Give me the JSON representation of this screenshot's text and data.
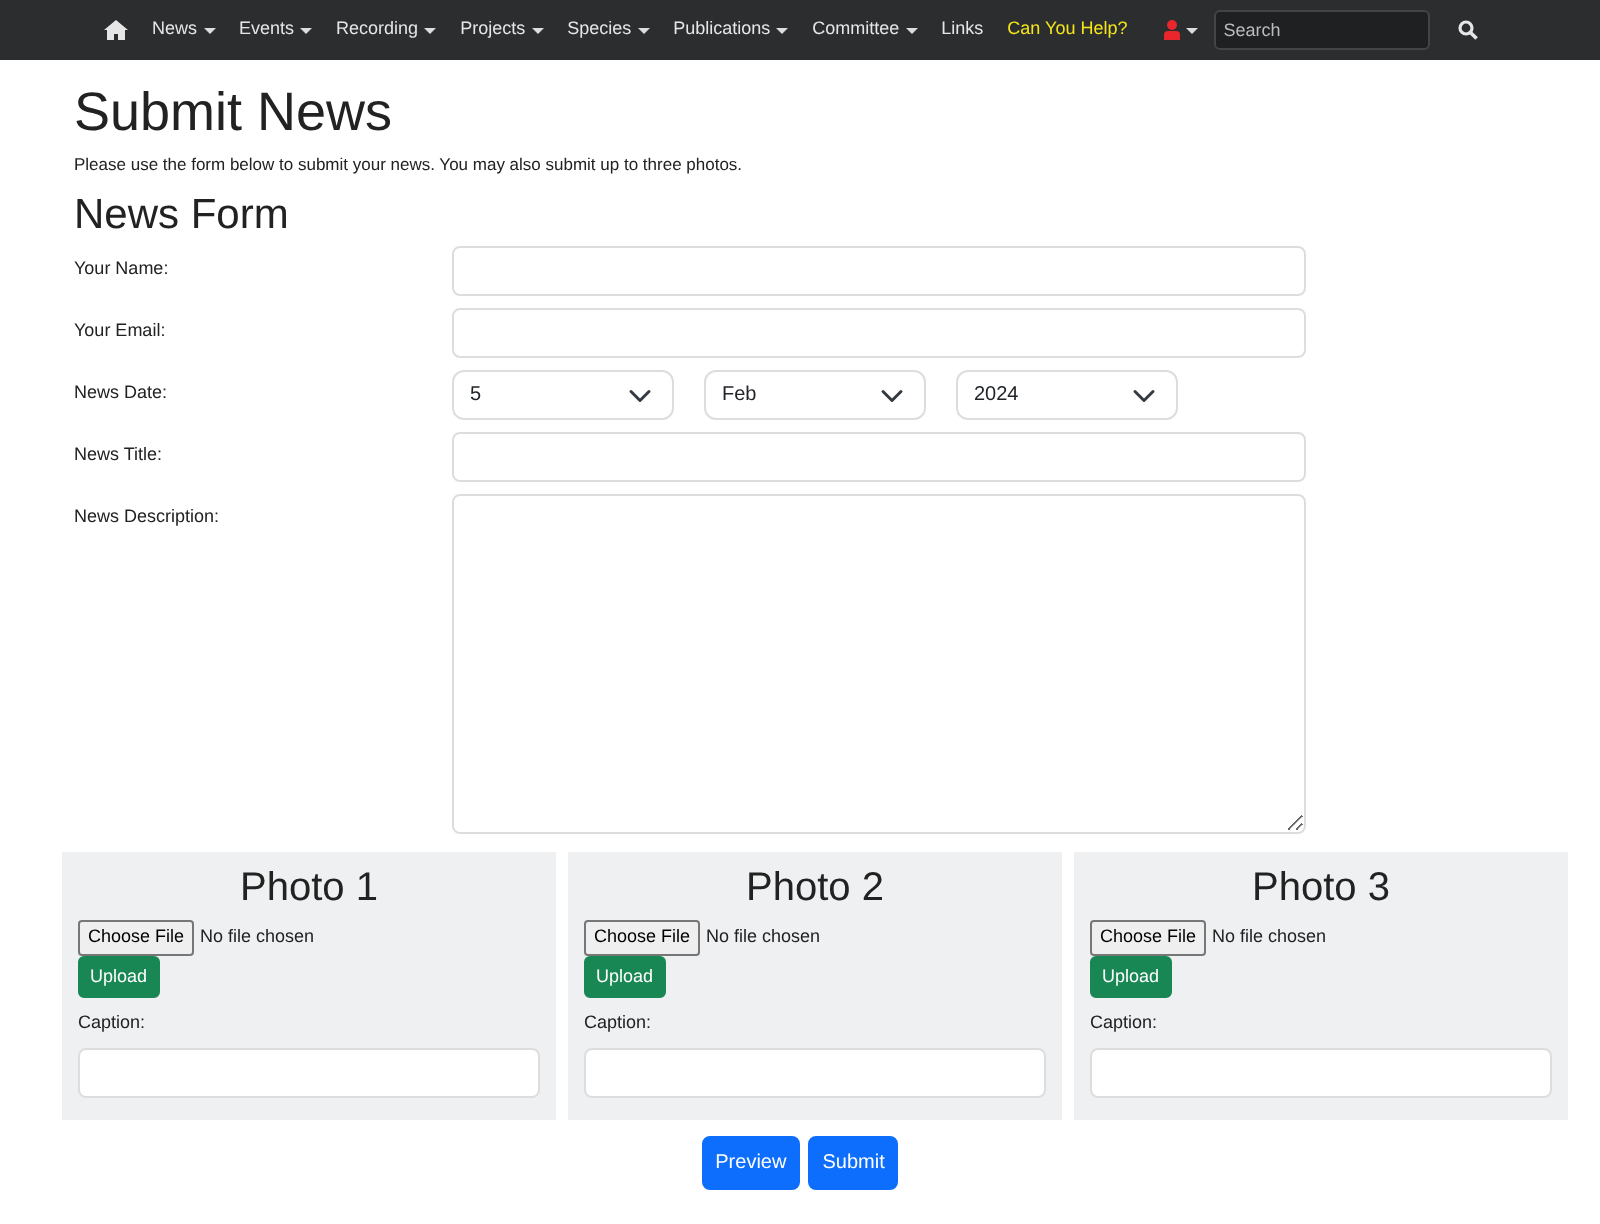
{
  "navbar": {
    "items": [
      {
        "kind": "home",
        "dropdown": false,
        "highlight": false
      },
      {
        "kind": "link",
        "label": "News",
        "dropdown": true,
        "highlight": false
      },
      {
        "kind": "link",
        "label": "Events",
        "dropdown": true,
        "highlight": false
      },
      {
        "kind": "link",
        "label": "Recording",
        "dropdown": true,
        "highlight": false
      },
      {
        "kind": "link",
        "label": "Projects",
        "dropdown": true,
        "highlight": false
      },
      {
        "kind": "link",
        "label": "Species",
        "dropdown": true,
        "highlight": false
      },
      {
        "kind": "link",
        "label": "Publications",
        "dropdown": true,
        "highlight": false
      },
      {
        "kind": "link",
        "label": "Committee",
        "dropdown": true,
        "highlight": false
      },
      {
        "kind": "link",
        "label": "Links",
        "dropdown": false,
        "highlight": false
      },
      {
        "kind": "link",
        "label": "Can You Help?",
        "dropdown": false,
        "highlight": true
      },
      {
        "kind": "user",
        "dropdown": true,
        "highlight": false
      }
    ],
    "search": {
      "placeholder": "Search"
    }
  },
  "page": {
    "title": "Submit News",
    "intro": "Please use the form below to submit your news. You may also submit up to three photos."
  },
  "form": {
    "title": "News Form",
    "fields": [
      {
        "kind": "text",
        "label": "Your Name:"
      },
      {
        "kind": "text",
        "label": "Your Email:"
      },
      {
        "kind": "date",
        "label": "News Date:",
        "values": [
          "5",
          "Feb",
          "2024"
        ]
      },
      {
        "kind": "text",
        "label": "News Title:"
      },
      {
        "kind": "textarea",
        "label": "News Description:"
      }
    ]
  },
  "photos": [
    {
      "title": "Photo 1",
      "file_button": "Choose File",
      "file_status": "No file chosen",
      "upload": "Upload",
      "caption_label": "Caption:"
    },
    {
      "title": "Photo 2",
      "file_button": "Choose File",
      "file_status": "No file chosen",
      "upload": "Upload",
      "caption_label": "Caption:"
    },
    {
      "title": "Photo 3",
      "file_button": "Choose File",
      "file_status": "No file chosen",
      "upload": "Upload",
      "caption_label": "Caption:"
    }
  ],
  "buttons": [
    "Preview",
    "Submit"
  ]
}
